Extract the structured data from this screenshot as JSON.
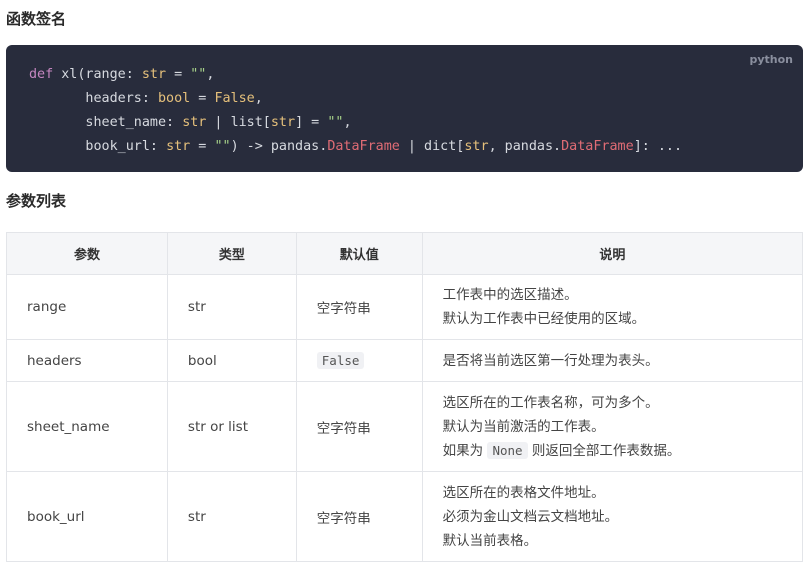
{
  "headings": {
    "signature": "函数签名",
    "params": "参数列表"
  },
  "code": {
    "language": "python",
    "line1": {
      "kw": "def",
      "fn": " xl(range: ",
      "t1": "str",
      "eq1": " = ",
      "s1": "\"\"",
      "end": ","
    },
    "line2": {
      "indent": "       headers: ",
      "t": "bool",
      "eq": " = ",
      "v": "False",
      "end": ","
    },
    "line3": {
      "indent": "       sheet_name: ",
      "t1": "str",
      "bar": " | ",
      "fn": "list[",
      "t2": "str",
      "close": "] = ",
      "s": "\"\"",
      "end": ","
    },
    "line4": {
      "indent": "       book_url: ",
      "t1": "str",
      "eq": " = ",
      "s": "\"\"",
      "ret": ") -> pandas.",
      "c1": "DataFrame",
      "bar": " | dict[",
      "t2": "str",
      "comma": ", pandas.",
      "c2": "DataFrame",
      "end": "]: ..."
    }
  },
  "table": {
    "headers": [
      "参数",
      "类型",
      "默认值",
      "说明"
    ],
    "rows": [
      {
        "name": "range",
        "type": "str",
        "default": "空字符串",
        "desc": [
          "工作表中的选区描述。",
          "默认为工作表中已经使用的区域。"
        ]
      },
      {
        "name": "headers",
        "type": "bool",
        "default": "False",
        "desc": [
          "是否将当前选区第一行处理为表头。"
        ]
      },
      {
        "name": "sheet_name",
        "type": "str or list",
        "default": "空字符串",
        "desc": [
          "选区所在的工作表名称，可为多个。",
          "默认为当前激活的工作表。"
        ],
        "desc_note": {
          "pre": "如果为 ",
          "code": "None",
          "post": " 则返回全部工作表数据。"
        }
      },
      {
        "name": "book_url",
        "type": "str",
        "default": "空字符串",
        "desc": [
          "选区所在的表格文件地址。",
          "必须为金山文档云文档地址。",
          "默认当前表格。"
        ]
      }
    ]
  }
}
